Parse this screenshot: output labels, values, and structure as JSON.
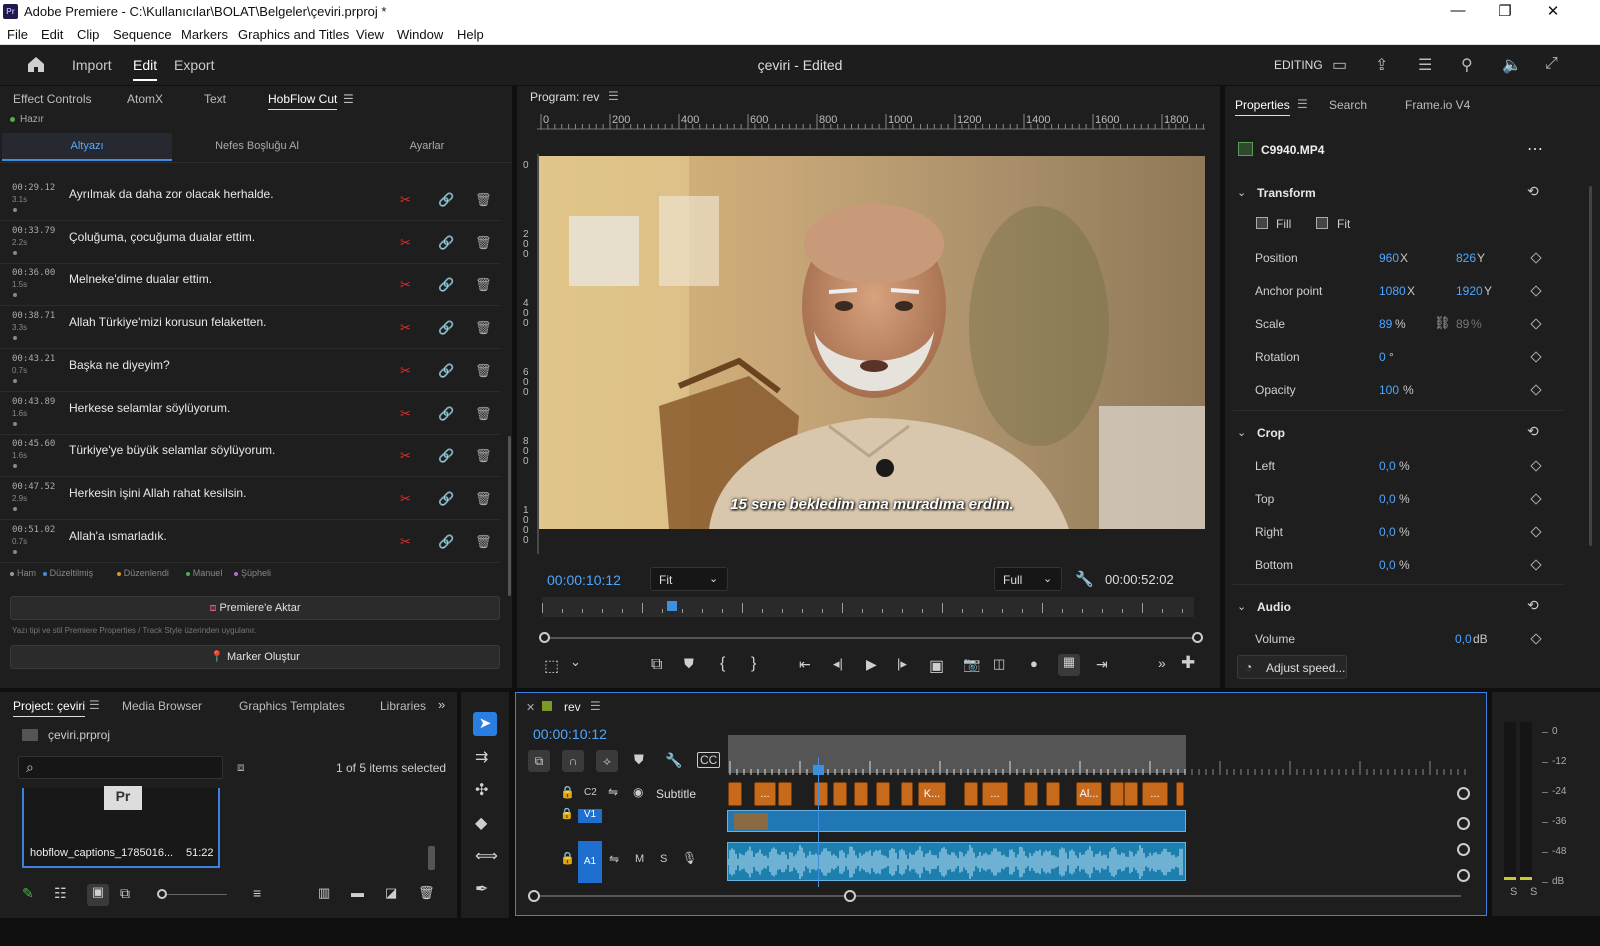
{
  "window": {
    "title": "Adobe Premiere - C:\\Kullanıcılar\\BOLAT\\Belgeler\\çeviri.prproj *",
    "app_icon": "Pr"
  },
  "menu": [
    "File",
    "Edit",
    "Clip",
    "Sequence",
    "Markers",
    "Graphics and Titles",
    "View",
    "Window",
    "Help"
  ],
  "header": {
    "tabs": [
      "Import",
      "Edit",
      "Export"
    ],
    "active_tab": "Edit",
    "project": "çeviri - Edited",
    "workspace": "EDITING"
  },
  "left_panel": {
    "tabs": [
      "Effect Controls",
      "AtomX",
      "Text",
      "HobFlow Cut"
    ],
    "active_tab": "HobFlow Cut",
    "status": "Hazır",
    "subtabs": [
      "Altyazı",
      "Nefes Boşluğu Al",
      "Ayarlar"
    ],
    "subtitles": [
      {
        "time": "00:29.12",
        "dur": "3.1s",
        "text": "Ayrılmak da daha zor olacak herhalde."
      },
      {
        "time": "00:33.79",
        "dur": "2.2s",
        "text": "Çoluğuma, çocuğuma dualar ettim."
      },
      {
        "time": "00:36.00",
        "dur": "1.5s",
        "text": "Melneke'dime dualar ettim."
      },
      {
        "time": "00:38.71",
        "dur": "3.3s",
        "text": "Allah Türkiye'mizi korusun felaketten."
      },
      {
        "time": "00:43.21",
        "dur": "0.7s",
        "text": "Başka ne diyeyim?"
      },
      {
        "time": "00:43.89",
        "dur": "1.6s",
        "text": "Herkese selamlar söylüyorum."
      },
      {
        "time": "00:45.60",
        "dur": "1.6s",
        "text": "Türkiye'ye büyük selamlar söylüyorum."
      },
      {
        "time": "00:47.52",
        "dur": "2.9s",
        "text": "Herkesin işini Allah rahat kesilsin."
      },
      {
        "time": "00:51.02",
        "dur": "0.7s",
        "text": "Allah'a ısmarladık."
      }
    ],
    "legend": [
      {
        "label": "Ham",
        "color": "#9a9a9a"
      },
      {
        "label": "Düzeltilmiş",
        "color": "#3f8fe0"
      },
      {
        "label": "Düzenlendi",
        "color": "#d49a2a"
      },
      {
        "label": "Manuel",
        "color": "#4caf50"
      },
      {
        "label": "Şüpheli",
        "color": "#b070d0"
      }
    ],
    "btn_export": "Premiere'e Aktar",
    "note": "Yazı tipi ve stil Premiere Properties / Track Style üzerinden uygulanır.",
    "btn_marker": "Marker Oluştur"
  },
  "program": {
    "title": "Program: rev",
    "ruler": [
      "0",
      "200",
      "400",
      "600",
      "800",
      "1000",
      "1200",
      "1400",
      "1600",
      "1800"
    ],
    "vruler": [
      "0",
      "200",
      "400",
      "600",
      "800",
      "1000"
    ],
    "caption": "15 sene bekledim ama muradıma erdim.",
    "timecode": "00:00:10:12",
    "fit": "Fit",
    "quality": "Full",
    "duration": "00:00:52:02",
    "playhead_fraction": 0.2
  },
  "properties": {
    "tabs": [
      "Properties",
      "Search",
      "Frame.io V4"
    ],
    "clip": "C9940.MP4",
    "transform": "Transform",
    "fill": "Fill",
    "fit": "Fit",
    "position": {
      "label": "Position",
      "x": "960",
      "y": "826"
    },
    "anchor": {
      "label": "Anchor point",
      "x": "1080",
      "y": "1920"
    },
    "scale": {
      "label": "Scale",
      "value": "89",
      "linked": "89"
    },
    "rotation": {
      "label": "Rotation",
      "value": "0"
    },
    "opacity": {
      "label": "Opacity",
      "value": "100"
    },
    "crop": "Crop",
    "crop_items": [
      {
        "label": "Left",
        "value": "0,0"
      },
      {
        "label": "Top",
        "value": "0,0"
      },
      {
        "label": "Right",
        "value": "0,0"
      },
      {
        "label": "Bottom",
        "value": "0,0"
      }
    ],
    "audio": "Audio",
    "volume": {
      "label": "Volume",
      "value": "0,0",
      "unit": "dB"
    },
    "adjust_speed": "Adjust speed..."
  },
  "project_panel": {
    "tabs": [
      "Project: çeviri",
      "Media Browser",
      "Graphics Templates",
      "Libraries"
    ],
    "file": "çeviri.prproj",
    "selected_count": "1 of 5 items selected",
    "item_name": "hobflow_captions_1785016...",
    "item_dur": "51:22",
    "thumb_text": "Pr"
  },
  "timeline": {
    "seq": "rev",
    "timecode": "00:00:10:12",
    "tracks": [
      {
        "id": "C2",
        "name": "Subtitle"
      },
      {
        "id": "V1",
        "name": ""
      },
      {
        "id": "A1",
        "name": ""
      }
    ],
    "clip_labels": [
      "...",
      "K...",
      "...",
      "Al...",
      "..."
    ],
    "playhead_fraction": 0.2
  },
  "meter": {
    "scale": [
      "0",
      "-12",
      "-24",
      "-36",
      "-48",
      "dB"
    ],
    "solo": [
      "S",
      "S"
    ]
  },
  "colors": {
    "accent": "#4ea6ff",
    "playhead": "#3f8fe0",
    "clip_orange": "#c86a1c",
    "video_clip": "#1f78b4",
    "audio_clip": "#1c7fae"
  }
}
